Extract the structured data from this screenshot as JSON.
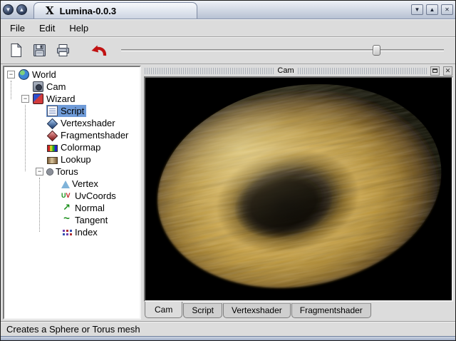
{
  "window": {
    "title": "Lumina-0.0.3",
    "logo_glyph": "X"
  },
  "titlebar": {
    "left_buttons": [
      {
        "name": "shade-button",
        "glyph": "▼"
      },
      {
        "name": "unshade-button",
        "glyph": "▲"
      }
    ],
    "right_buttons": [
      {
        "name": "minimize-button",
        "glyph": "▼"
      },
      {
        "name": "maximize-button",
        "glyph": "▲"
      },
      {
        "name": "close-button",
        "glyph": "✕"
      }
    ]
  },
  "menubar": {
    "items": [
      "File",
      "Edit",
      "Help"
    ]
  },
  "toolbar": {
    "buttons": [
      "New",
      "Save",
      "Print",
      "Undo"
    ],
    "slider_value_pct": 78
  },
  "tree": {
    "items": [
      {
        "label": "World",
        "depth": 0,
        "icon": "world-icon",
        "expanded": true
      },
      {
        "label": "Cam",
        "depth": 1,
        "icon": "camera-icon"
      },
      {
        "label": "Wizard",
        "depth": 1,
        "icon": "wizard-icon",
        "expanded": true
      },
      {
        "label": "Script",
        "depth": 2,
        "icon": "script-icon",
        "selected": true
      },
      {
        "label": "Vertexshader",
        "depth": 2,
        "icon": "vertexshader-icon"
      },
      {
        "label": "Fragmentshader",
        "depth": 2,
        "icon": "fragmentshader-icon"
      },
      {
        "label": "Colormap",
        "depth": 2,
        "icon": "colormap-icon"
      },
      {
        "label": "Lookup",
        "depth": 2,
        "icon": "lookup-icon"
      },
      {
        "label": "Torus",
        "depth": 2,
        "icon": "torus-icon",
        "expanded": true
      },
      {
        "label": "Vertex",
        "depth": 3,
        "icon": "vertex-icon"
      },
      {
        "label": "UvCoords",
        "depth": 3,
        "icon": "uvcoords-icon"
      },
      {
        "label": "Normal",
        "depth": 3,
        "icon": "normal-icon"
      },
      {
        "label": "Tangent",
        "depth": 3,
        "icon": "tangent-icon"
      },
      {
        "label": "Index",
        "depth": 3,
        "icon": "index-icon"
      }
    ]
  },
  "dock": {
    "title": "Cam",
    "close_glyph": "✕"
  },
  "tabs": {
    "items": [
      "Cam",
      "Script",
      "Vertexshader",
      "Fragmentshader"
    ],
    "active": "Cam"
  },
  "statusbar": {
    "text": "Creates a Sphere or Torus mesh"
  },
  "icons": {
    "collapse_glyph": "−",
    "uv_u": "U",
    "uv_v": "V",
    "normal_glyph": "↗",
    "tangent_glyph": "~"
  },
  "colors": {
    "selection": "#6f9bd8",
    "window_bg": "#dcdcdc",
    "viewport_bg": "#000000",
    "torus_gold": "#c49a3c",
    "undo_red": "#c11212"
  }
}
